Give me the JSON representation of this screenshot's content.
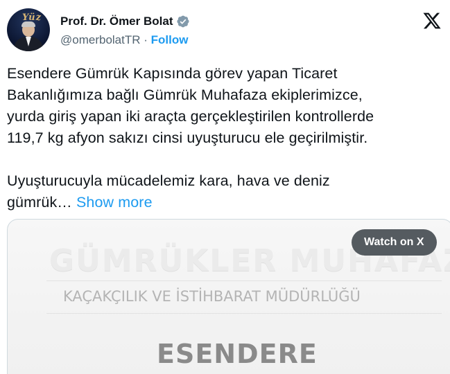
{
  "author": {
    "display_name": "Prof. Dr. Ömer Bolat",
    "handle": "@omerbolatTR",
    "separator": "·",
    "follow_label": "Follow",
    "avatar_sign": "Yüz"
  },
  "tweet": {
    "lines": [
      "Esendere Gümrük Kapısında görev yapan Ticaret",
      "Bakanlığımıza bağlı Gümrük Muhafaza ekiplerimizce,",
      "yurda giriş yapan iki araçta gerçekleştirilen kontrollerde",
      "119,7 kg afyon sakızı cinsi uyuşturucu ele geçirilmiştir."
    ],
    "lines2": [
      "Uyuşturucuyla mücadelemiz kara, hava ve deniz",
      "gümrük…"
    ],
    "show_more": "Show more"
  },
  "media": {
    "watch_label": "Watch on X",
    "video_title": "GÜMRÜKLER MUHAFAZA",
    "video_subtitle": "KAÇAKÇILIK VE İSTİHBARAT MÜDÜRLÜĞÜ",
    "video_location": "ESENDERE"
  },
  "colors": {
    "link": "#1d9bf0",
    "verified": "#829aab",
    "text": "#0f1419",
    "secondary": "#536471"
  },
  "icons": {
    "verified": "verified-badge-icon",
    "brand": "x-logo-icon"
  }
}
